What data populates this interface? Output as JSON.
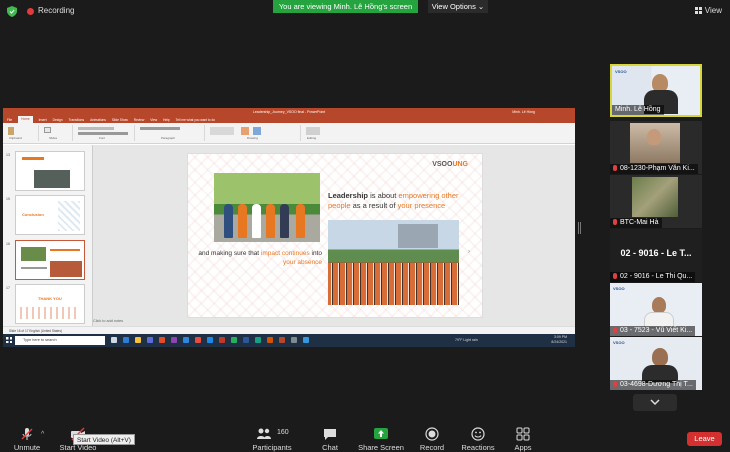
{
  "topbar": {
    "recording_label": "Recording",
    "viewing_banner": "You are viewing Minh. Lê Hồng's screen",
    "view_options_label": "View Options",
    "view_label": "View"
  },
  "shared_screen": {
    "ppt_window_title": "Leadership_Journey_VSOO final - PowerPoint",
    "ppt_user": "Minh. Lê Hồng",
    "ribbon_tabs": [
      "File",
      "Home",
      "Insert",
      "Design",
      "Transitions",
      "Animations",
      "Slide Show",
      "Review",
      "View",
      "Help",
      "Tell me what you want to do"
    ],
    "active_tab": "Home",
    "ribbon_groups": [
      "Clipboard",
      "Slides",
      "Font",
      "Paragraph",
      "Drawing",
      "Editing"
    ],
    "thumbnails": [
      {
        "num": "13",
        "title": ""
      },
      {
        "num": "15",
        "title": "Conclusion"
      },
      {
        "num": "16",
        "title": ""
      },
      {
        "num": "17",
        "title": "THANK YOU"
      }
    ],
    "slide": {
      "logo_main": "VSOO",
      "logo_accent": "UNG",
      "quote1_a": "Leadership",
      "quote1_b": " is about ",
      "quote1_c": "empowering other people",
      "quote1_d": " as a result of ",
      "quote1_e": "your presence",
      "quote2_a": "and making sure that ",
      "quote2_b": "impact continues",
      "quote2_c": " into ",
      "quote2_d": "your absence"
    },
    "notes_placeholder": "Click to add notes",
    "status_text": "Slide 16 of 17   English (United States)",
    "taskbar_search": "Type here to search",
    "weather": "79°F  Light rain",
    "clock_time": "3:09 PM",
    "clock_date": "8/24/2021"
  },
  "participants": [
    {
      "name": "Minh. Lê Hồng",
      "muted": false,
      "active": true,
      "video": true
    },
    {
      "name": "08-1230-Phạm Văn Ki...",
      "muted": true,
      "active": false,
      "video": true
    },
    {
      "name": "BTC-Mai Hà",
      "muted": true,
      "active": false,
      "video": true
    },
    {
      "name": "02 - 9016 - Le Thi Qu...",
      "big_name": "02 - 9016 - Le T...",
      "muted": true,
      "active": false,
      "video": false
    },
    {
      "name": "03 - 7523 - Vũ Viết Ki...",
      "muted": true,
      "active": false,
      "video": true
    },
    {
      "name": "03-4698-Dương Thị T...",
      "muted": true,
      "active": false,
      "video": true
    }
  ],
  "toolbar": {
    "unmute": "Unmute",
    "start_video": "Start Video",
    "start_video_tooltip": "Start Video (Alt+V)",
    "participants": "Participants",
    "participants_count": "160",
    "chat": "Chat",
    "share_screen": "Share Screen",
    "record": "Record",
    "reactions": "Reactions",
    "apps": "Apps",
    "leave": "Leave"
  },
  "colors": {
    "share_green": "#25a33f",
    "leave_red": "#d3302f",
    "ppt_red": "#b7472a",
    "slide_orange": "#e87722",
    "active_speaker": "#d6d639"
  }
}
